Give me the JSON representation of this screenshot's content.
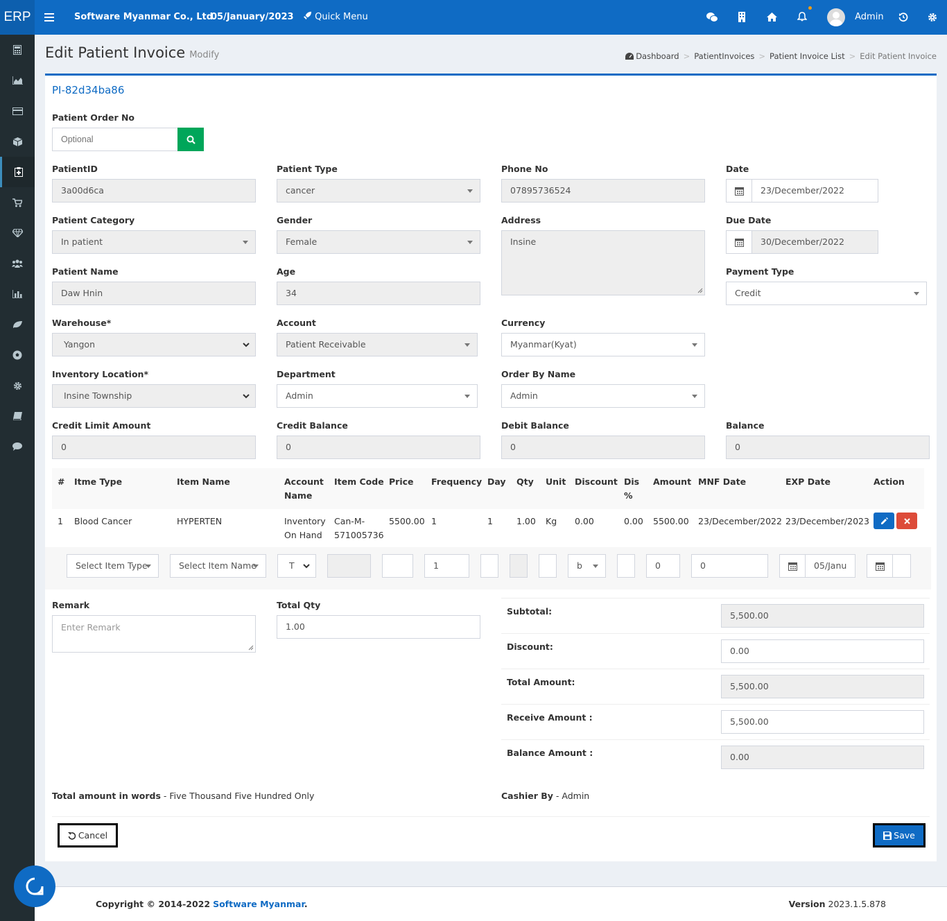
{
  "topbar": {
    "logo": "ERP",
    "company": "Software Myanmar Co., Ltd",
    "date": "05/January/2023",
    "quick_menu": "Quick Menu",
    "user": "Admin"
  },
  "page": {
    "title": "Edit Patient Invoice",
    "subtitle": "Modify"
  },
  "breadcrumb": {
    "dashboard": "Dashboard",
    "patientinvoices": "PatientInvoices",
    "list": "Patient Invoice List",
    "current": "Edit Patient Invoice"
  },
  "invoice_no": "PI-82d34ba86",
  "form": {
    "patient_order_no": {
      "label": "Patient Order No",
      "placeholder": "Optional"
    },
    "patient_id": {
      "label": "PatientID",
      "value": "3a00d6ca"
    },
    "patient_type": {
      "label": "Patient Type",
      "value": "cancer"
    },
    "phone_no": {
      "label": "Phone No",
      "value": "07895736524"
    },
    "date": {
      "label": "Date",
      "value": "23/December/2022"
    },
    "patient_category": {
      "label": "Patient Category",
      "value": "In patient"
    },
    "gender": {
      "label": "Gender",
      "value": "Female"
    },
    "address": {
      "label": "Address",
      "value": "Insine"
    },
    "due_date": {
      "label": "Due Date",
      "value": "30/December/2022"
    },
    "patient_name": {
      "label": "Patient Name",
      "value": "Daw Hnin"
    },
    "age": {
      "label": "Age",
      "value": "34"
    },
    "payment_type": {
      "label": "Payment Type",
      "value": "Credit"
    },
    "warehouse": {
      "label": "Warehouse*",
      "value": "Yangon"
    },
    "account": {
      "label": "Account",
      "value": "Patient Receivable"
    },
    "currency": {
      "label": "Currency",
      "value": "Myanmar(Kyat)"
    },
    "inventory_location": {
      "label": "Inventory Location*",
      "value": "Insine Township"
    },
    "department": {
      "label": "Department",
      "value": "Admin"
    },
    "order_by_name": {
      "label": "Order By Name",
      "value": "Admin"
    },
    "credit_limit": {
      "label": "Credit Limit Amount",
      "value": "0"
    },
    "credit_balance": {
      "label": "Credit Balance",
      "value": "0"
    },
    "debit_balance": {
      "label": "Debit Balance",
      "value": "0"
    },
    "balance": {
      "label": "Balance",
      "value": "0"
    }
  },
  "table": {
    "headers": {
      "no": "#",
      "item_type": "Itme Type",
      "item_name": "Item Name",
      "account_name_1": "Account",
      "account_name_2": "Name",
      "item_code": "Item Code",
      "price": "Price",
      "frequency": "Frequency",
      "day": "Day",
      "qty": "Qty",
      "unit": "Unit",
      "discount": "Discount",
      "dis_pct_1": "Dis",
      "dis_pct_2": "%",
      "amount": "Amount",
      "mnf_date": "MNF Date",
      "exp_date": "EXP Date",
      "action": "Action"
    },
    "row": {
      "no": "1",
      "item_type": "Blood Cancer",
      "item_name": "HYPERTEN",
      "account_1": "Inventory",
      "account_2": "On Hand",
      "code_1": "Can-M-",
      "code_2": "571005736",
      "price": "5500.00",
      "frequency": "1",
      "day": "1",
      "qty": "1.00",
      "unit": "Kg",
      "discount": "0.00",
      "dis_pct": "0.00",
      "amount": "5500.00",
      "mnf_date": "23/December/2022",
      "exp_date": "23/December/2023"
    },
    "entry": {
      "item_type": "Select Item Type",
      "item_name": "Select Item Name",
      "account": "T",
      "frequency": "1",
      "unit": "b",
      "amount": "0",
      "mnf": "0",
      "exp": "05/Janu"
    }
  },
  "bottom": {
    "remark": {
      "label": "Remark",
      "placeholder": "Enter Remark"
    },
    "total_qty": {
      "label": "Total Qty",
      "value": "1.00"
    },
    "subtotal": {
      "label": "Subtotal:",
      "value": "5,500.00"
    },
    "discount": {
      "label": "Discount:",
      "value": "0.00"
    },
    "total_amount": {
      "label": "Total Amount:",
      "value": "5,500.00"
    },
    "receive_amount": {
      "label": "Receive Amount :",
      "value": "5,500.00"
    },
    "balance_amount": {
      "label": "Balance Amount :",
      "value": "0.00"
    },
    "words_label": "Total amount in words",
    "words_value": "- Five Thousand Five Hundred Only",
    "cashier_label": "Cashier By",
    "cashier_value": "- Admin",
    "cancel": "Cancel",
    "save": "Save"
  },
  "footer": {
    "copyright": "Copyright © 2014-2022",
    "company": "Software Myanmar",
    "dot": ".",
    "version_label": "Version",
    "version": "2023.1.5.878"
  },
  "colors": {
    "primary": "#0f6bc4",
    "sidebar": "#222d32",
    "success": "#00a65a",
    "danger": "#dd4b39"
  }
}
